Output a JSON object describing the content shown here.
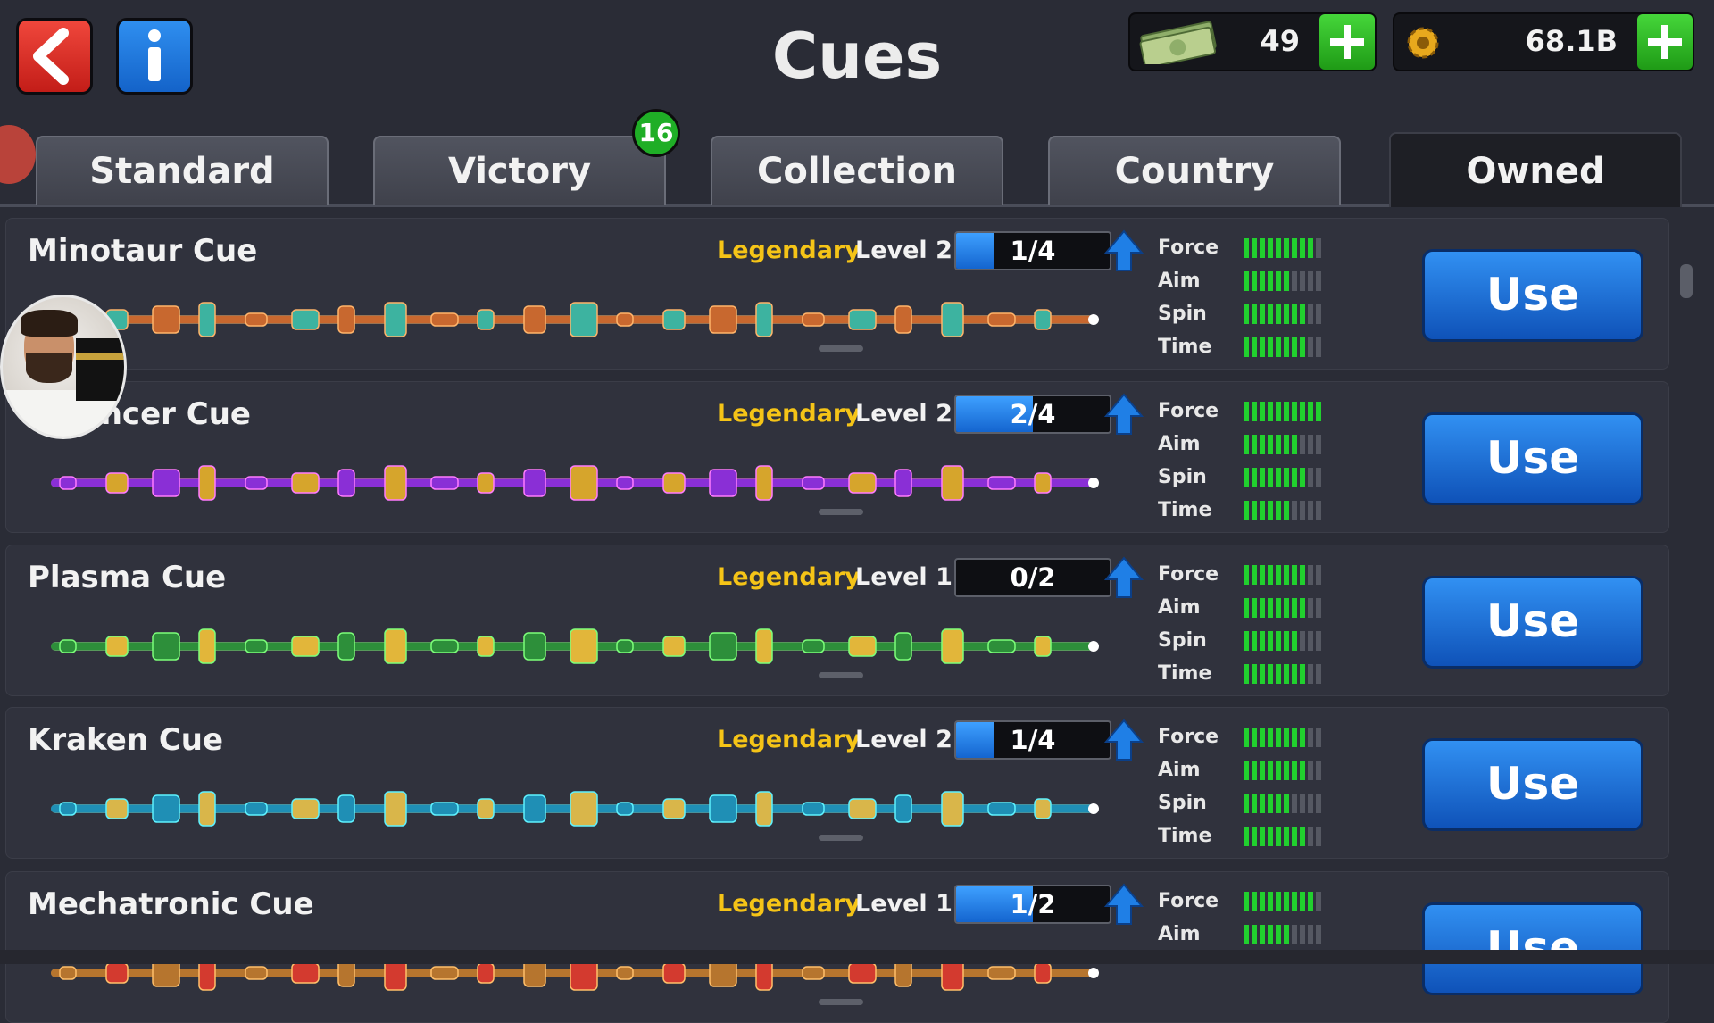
{
  "header": {
    "title": "Cues",
    "cash": {
      "value": "49",
      "icon": "cash-bill-icon"
    },
    "coins": {
      "value": "68.1B",
      "icon": "coin-gear-icon"
    }
  },
  "tabs": [
    {
      "label": "Standard",
      "active": false
    },
    {
      "label": "Victory",
      "active": false,
      "badge": "16"
    },
    {
      "label": "Collection",
      "active": false
    },
    {
      "label": "Country",
      "active": false
    },
    {
      "label": "Owned",
      "active": true
    }
  ],
  "stat_labels": [
    "Force",
    "Aim",
    "Spin",
    "Time"
  ],
  "cues": [
    {
      "name": "Minotaur Cue",
      "rarity": "Legendary",
      "level": "Level 2",
      "progress": "1/4",
      "progress_fraction": 0.25,
      "stats": [
        9,
        6,
        8,
        8
      ],
      "button": "Use"
    },
    {
      "name": "Necromancer Cue",
      "visible_name": "omancer Cue",
      "rarity": "Legendary",
      "level": "Level 2",
      "progress": "2/4",
      "progress_fraction": 0.5,
      "stats": [
        10,
        7,
        8,
        6
      ],
      "button": "Use"
    },
    {
      "name": "Plasma Cue",
      "rarity": "Legendary",
      "level": "Level 1",
      "progress": "0/2",
      "progress_fraction": 0,
      "stats": [
        8,
        8,
        7,
        8
      ],
      "button": "Use"
    },
    {
      "name": "Kraken Cue",
      "rarity": "Legendary",
      "level": "Level 2",
      "progress": "1/4",
      "progress_fraction": 0.25,
      "stats": [
        8,
        8,
        6,
        8
      ],
      "button": "Use"
    },
    {
      "name": "Mechatronic Cue",
      "rarity": "Legendary",
      "level": "Level 1",
      "progress": "1/2",
      "progress_fraction": 0.5,
      "stats": [
        9,
        6
      ],
      "button": "Use"
    }
  ],
  "colors": {
    "accent_blue": "#1f74e0",
    "stat_green": "#21d02e",
    "legendary_gold": "#f5c417",
    "plus_green": "#2fbf25",
    "back_red": "#d72a22"
  }
}
